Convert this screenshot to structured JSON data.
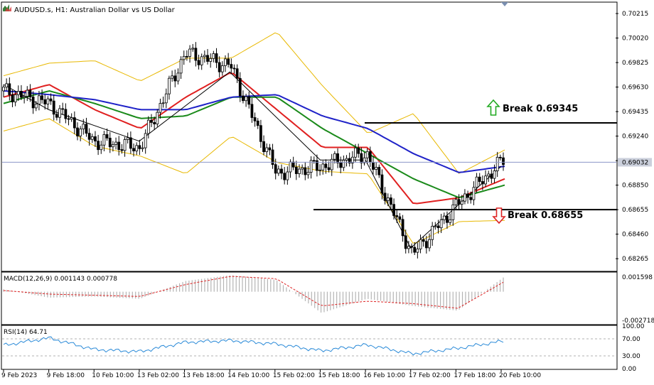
{
  "header": {
    "title": "AUDUSD.s, H1:  Australian Dollar vs US Dollar"
  },
  "price_panel": {
    "axis_labels": [
      "0.70215",
      "0.70020",
      "0.69825",
      "0.69630",
      "0.69435",
      "0.69240",
      "0.69045",
      "0.68850",
      "0.68655",
      "0.68460",
      "0.68265"
    ],
    "current_price": "0.69032",
    "annotations": {
      "break_up": "Break 0.69345",
      "break_down": "Break 0.68655"
    }
  },
  "macd_panel": {
    "label": "MACD(12,26,9) 0.001143 0.000778",
    "axis_labels": [
      "0.001598",
      "-0.002718"
    ]
  },
  "rsi_panel": {
    "label": "RSI(14) 64.71",
    "axis_labels": [
      "100.00",
      "70.00",
      "30.00",
      "0.00"
    ]
  },
  "time_axis": {
    "labels": [
      "9 Feb 2023",
      "9 Feb 18:00",
      "10 Feb 10:00",
      "13 Feb 02:00",
      "13 Feb 18:00",
      "14 Feb 10:00",
      "15 Feb 02:00",
      "15 Feb 18:00",
      "16 Feb 10:00",
      "17 Feb 02:00",
      "17 Feb 18:00",
      "20 Feb 10:00"
    ]
  },
  "colors": {
    "background": "#ffffff",
    "grid_border": "#000000",
    "candle": "#000000",
    "ma_fast": "#e02020",
    "ma_mid": "#1a8a1a",
    "ma_slow": "#1f22c8",
    "bollinger": "#e8b800",
    "current_line": "#8c96c8",
    "arrow_up": "#22aa22",
    "arrow_down": "#dd2222",
    "macd_hist": "#b4b4b4",
    "macd_signal": "#dd2222",
    "rsi_line": "#2a8ad8",
    "axis_text": "#000000"
  },
  "chart_data": {
    "type": "line",
    "instrument": "AUDUSD.s",
    "timeframe": "H1",
    "x": [
      "9 Feb 2023",
      "9 Feb 18:00",
      "10 Feb 10:00",
      "13 Feb 02:00",
      "13 Feb 18:00",
      "14 Feb 10:00",
      "15 Feb 02:00",
      "15 Feb 18:00",
      "16 Feb 10:00",
      "17 Feb 02:00",
      "17 Feb 18:00",
      "20 Feb 10:00"
    ],
    "ylim": [
      0.6817,
      0.703
    ],
    "current_price": 0.69032,
    "horizontal_levels": [
      0.69345,
      0.68655
    ],
    "series": [
      {
        "values": [
          0.696,
          0.695,
          0.692,
          0.6915,
          0.699,
          0.698,
          0.6895,
          0.69,
          0.691,
          0.683,
          0.687,
          0.6905
        ]
      },
      {
        "values": [
          0.6955,
          0.6965,
          0.6945,
          0.693,
          0.6955,
          0.6975,
          0.6945,
          0.6915,
          0.6915,
          0.687,
          0.6875,
          0.689
        ]
      },
      {
        "values": [
          0.695,
          0.696,
          0.695,
          0.6938,
          0.694,
          0.6955,
          0.6955,
          0.693,
          0.691,
          0.689,
          0.6875,
          0.6885
        ]
      },
      {
        "values": [
          0.696,
          0.6957,
          0.6953,
          0.6945,
          0.6945,
          0.6955,
          0.6957,
          0.694,
          0.693,
          0.691,
          0.6895,
          0.69
        ]
      }
    ],
    "macd": {
      "ylim": [
        -0.002718,
        0.001598
      ],
      "histogram": [
        0.0002,
        -0.0005,
        -0.0004,
        -0.0006,
        0.0009,
        0.0014,
        0.001,
        -0.0018,
        -0.0006,
        -0.0012,
        -0.0016,
        0.0012
      ],
      "signal": [
        0.0001,
        -0.0002,
        -0.0003,
        -0.0004,
        0.0006,
        0.0013,
        0.0011,
        -0.0012,
        -0.0008,
        -0.001,
        -0.0014,
        0.0008
      ]
    },
    "rsi": {
      "ylim": [
        0,
        100
      ],
      "levels": [
        70,
        30
      ],
      "values": [
        55,
        72,
        45,
        40,
        62,
        66,
        58,
        42,
        56,
        35,
        48,
        64.71
      ]
    }
  }
}
